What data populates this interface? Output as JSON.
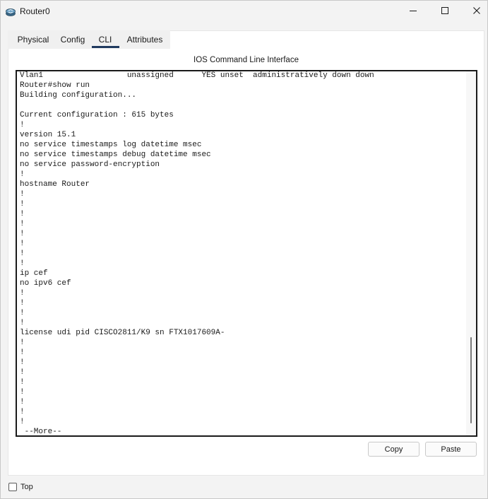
{
  "window": {
    "title": "Router0",
    "minimize_icon": "minimize-icon",
    "maximize_icon": "maximize-icon",
    "close_icon": "close-icon"
  },
  "tabs": [
    {
      "label": "Physical",
      "active": false
    },
    {
      "label": "Config",
      "active": false
    },
    {
      "label": "CLI",
      "active": true
    },
    {
      "label": "Attributes",
      "active": false
    }
  ],
  "cli": {
    "heading": "IOS Command Line Interface",
    "terminal_text": "Vlan1                  unassigned      YES unset  administratively down down\nRouter#show run\nBuilding configuration...\n\nCurrent configuration : 615 bytes\n!\nversion 15.1\nno service timestamps log datetime msec\nno service timestamps debug datetime msec\nno service password-encryption\n!\nhostname Router\n!\n!\n!\n!\n!\n!\n!\n!\nip cef\nno ipv6 cef\n!\n!\n!\n!\nlicense udi pid CISCO2811/K9 sn FTX1017609A-\n!\n!\n!\n!\n!\n!\n!\n!\n!\n --More--",
    "copy_label": "Copy",
    "paste_label": "Paste"
  },
  "footer": {
    "top_label": "Top",
    "top_checked": false
  },
  "colors": {
    "tab_underline": "#1f3a5f",
    "terminal_border": "#1a1a1a"
  }
}
